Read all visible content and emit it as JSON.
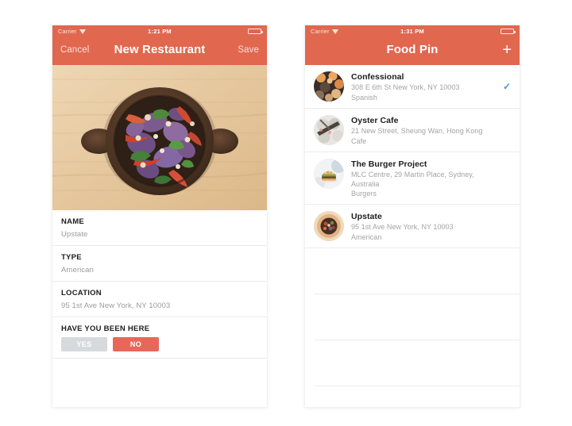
{
  "screens": {
    "left": {
      "status": {
        "carrier": "Carrier",
        "time": "1:21 PM",
        "wifi_icon": "wifi-icon",
        "battery_icon": "battery-icon"
      },
      "nav": {
        "left_label": "Cancel",
        "title": "New Restaurant",
        "right_label": "Save"
      },
      "hero": {
        "alt": "restaurant-photo"
      },
      "fields": [
        {
          "label": "NAME",
          "value": "Upstate"
        },
        {
          "label": "TYPE",
          "value": "American"
        },
        {
          "label": "LOCATION",
          "value": "95 1st Ave New York, NY 10003"
        }
      ],
      "visited": {
        "label": "HAVE YOU BEEN HERE",
        "yes_label": "YES",
        "no_label": "NO",
        "selected": "NO",
        "inactive_color": "#d7dadc",
        "active_color": "#e7685a"
      }
    },
    "right": {
      "status": {
        "carrier": "Carrier",
        "time": "1:31 PM",
        "wifi_icon": "wifi-icon",
        "battery_icon": "battery-icon"
      },
      "nav": {
        "title": "Food Pin",
        "add_label": "+"
      },
      "rows": [
        {
          "name": "Confessional",
          "address": "308 E 6th St New York, NY 10003",
          "type": "Spanish",
          "checked": true,
          "check_icon": "checkmark-icon",
          "avatar": "confessional-thumbnail"
        },
        {
          "name": "Oyster Cafe",
          "address": "21 New Street, Sheung Wan, Hong Kong",
          "type": "Cafe",
          "checked": false,
          "check_icon": "checkmark-icon",
          "avatar": "oyster-cafe-thumbnail"
        },
        {
          "name": "The Burger Project",
          "address": "MLC Centre, 29 Martin Place, Sydney, Australia",
          "type": "Burgers",
          "checked": false,
          "check_icon": "checkmark-icon",
          "avatar": "burger-project-thumbnail"
        },
        {
          "name": "Upstate",
          "address": "95 1st Ave New York, NY 10003",
          "type": "American",
          "checked": false,
          "check_icon": "checkmark-icon",
          "avatar": "upstate-thumbnail"
        }
      ],
      "empty_row_count": 3
    }
  },
  "theme": {
    "accent": "#e1674f",
    "check_blue": "#3d9ae8",
    "separator": "#ececec",
    "label_dark": "#1d1d1d",
    "value_grey": "#9b9b9b",
    "background": "#ffffff"
  }
}
